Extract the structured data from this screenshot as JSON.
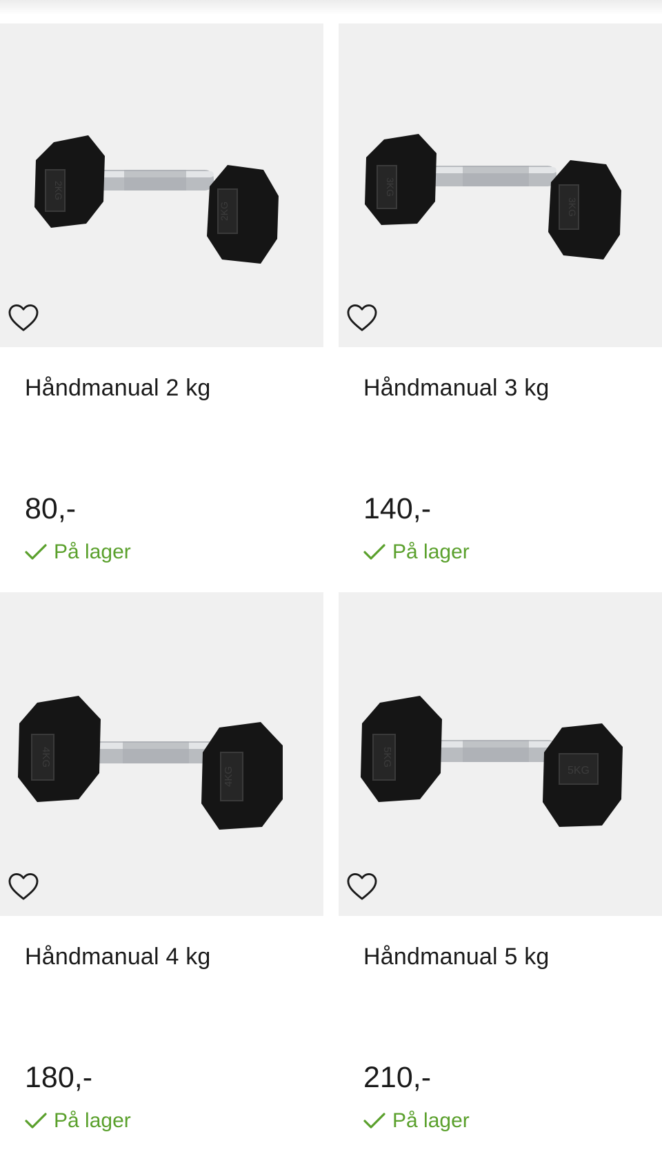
{
  "products": [
    {
      "title": "Håndmanual 2 kg",
      "price": "80,-",
      "stock": "På lager",
      "weight_label": "2KG"
    },
    {
      "title": "Håndmanual 3 kg",
      "price": "140,-",
      "stock": "På lager",
      "weight_label": "3KG"
    },
    {
      "title": "Håndmanual 4 kg",
      "price": "180,-",
      "stock": "På lager",
      "weight_label": "4KG"
    },
    {
      "title": "Håndmanual 5 kg",
      "price": "210,-",
      "stock": "På lager",
      "weight_label": "5KG"
    }
  ],
  "icons": {
    "favorite": "heart-outline-icon",
    "in_stock": "checkmark-icon"
  },
  "colors": {
    "image_background": "#f0f0f0",
    "text": "#1a1a1a",
    "in_stock": "#5aa02c"
  }
}
